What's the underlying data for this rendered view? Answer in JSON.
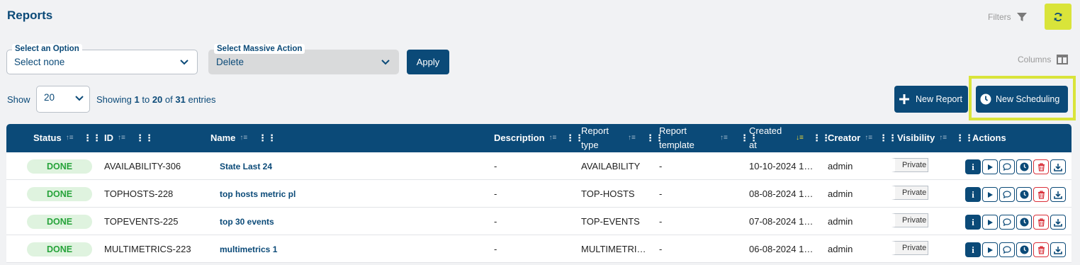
{
  "header": {
    "title": "Reports",
    "filters_label": "Filters",
    "columns_label": "Columns"
  },
  "controls": {
    "option_label": "Select an Option",
    "option_value": "Select none",
    "massive_label": "Select Massive Action",
    "massive_value": "Delete",
    "apply_label": "Apply",
    "show_label": "Show",
    "page_size": "20",
    "showing_prefix": "Showing",
    "showing_from": "1",
    "showing_to_word": "to",
    "showing_to": "20",
    "showing_of_word": "of",
    "showing_total": "31",
    "showing_suffix": "entries",
    "new_report_label": "New Report",
    "new_scheduling_label": "New Scheduling"
  },
  "table": {
    "columns": [
      "Status",
      "ID",
      "Name",
      "Description",
      "Report type",
      "Report template",
      "Created at",
      "Creator",
      "Visibility",
      "Actions"
    ],
    "rows": [
      {
        "status": "DONE",
        "id": "AVAILABILITY-306",
        "name": "State Last 24",
        "description": "-",
        "type": "AVAILABILITY",
        "template": "-",
        "created": "10-10-2024 1…",
        "creator": "admin",
        "visibility": "Private"
      },
      {
        "status": "DONE",
        "id": "TOPHOSTS-228",
        "name": "top hosts metric pl",
        "description": "-",
        "type": "TOP-HOSTS",
        "template": "-",
        "created": "08-08-2024 1…",
        "creator": "admin",
        "visibility": "Private"
      },
      {
        "status": "DONE",
        "id": "TOPEVENTS-225",
        "name": "top 30 events",
        "description": "-",
        "type": "TOP-EVENTS",
        "template": "-",
        "created": "07-08-2024 1…",
        "creator": "admin",
        "visibility": "Private"
      },
      {
        "status": "DONE",
        "id": "MULTIMETRICS-223",
        "name": "multimetrics 1",
        "description": "-",
        "type": "MULTIMETRI…",
        "template": "-",
        "created": "06-08-2024 1…",
        "creator": "admin",
        "visibility": "Private"
      }
    ]
  },
  "icons": [
    "filter-icon",
    "refresh-icon",
    "chevron-down-icon",
    "columns-icon",
    "plus-icon",
    "clock-icon",
    "sort-icon",
    "grip-icon",
    "info-icon",
    "play-icon",
    "comment-icon",
    "schedule-icon",
    "trash-icon",
    "download-icon"
  ],
  "colors": {
    "primary": "#0b4a78",
    "accent": "#d9e43a",
    "done_bg": "#dff3df",
    "done_text": "#26a33a",
    "danger": "#d9303a"
  }
}
